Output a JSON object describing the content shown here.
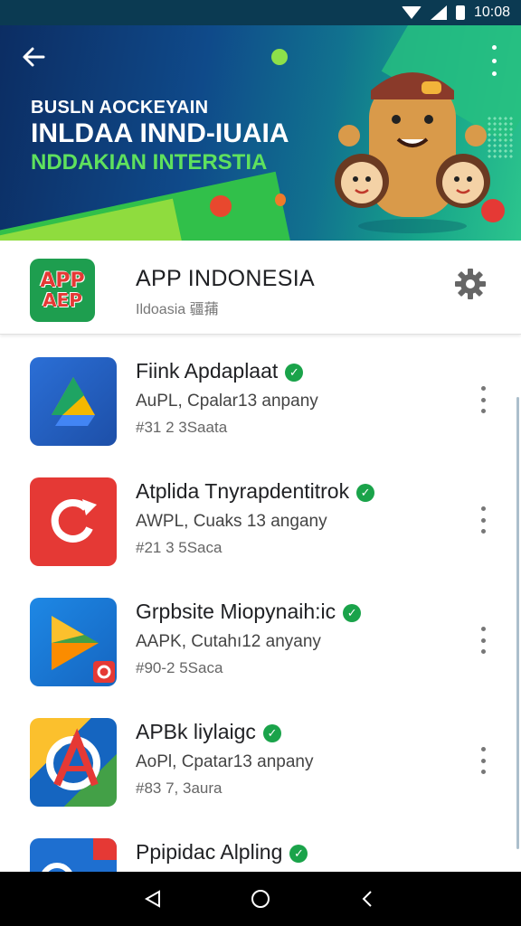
{
  "status_bar": {
    "time": "10:08"
  },
  "banner": {
    "line1": "BUSLN AOCKEYAIN",
    "line2": "INLDAA INND-IUAIA",
    "line3": "NDDAKIAN INTERSTIA"
  },
  "app": {
    "title": "APP INDONESIA",
    "subtitle": "Ildoasia  疆蒱",
    "logo_text_top": "APP",
    "logo_text_bottom": "AEP"
  },
  "list": [
    {
      "name": "Fiink Apdaplaat",
      "developer": "AuPL, Cpalar13 anpany",
      "meta": "#31 2 3Saata"
    },
    {
      "name": "Atplida Tnyrapdentitrok",
      "developer": "AWPL, Cuaks 13 angany",
      "meta": "#21 3 5Saca"
    },
    {
      "name": "Grpbsite Miopynaih:ic",
      "developer": "AAPK, Cutahı12 anyany",
      "meta": "#90-2 5Saca"
    },
    {
      "name": "APBk liylaigc",
      "developer": "AoPl, Cpatar13 anpany",
      "meta": "#83 7, 3aura"
    },
    {
      "name": "Ppipidac Alpling",
      "developer": "",
      "meta": ""
    }
  ],
  "colors": {
    "banner_dark": "#0c2d63",
    "banner_green": "#31c04a",
    "verified": "#1aa34a",
    "accent_red": "#e53935"
  }
}
